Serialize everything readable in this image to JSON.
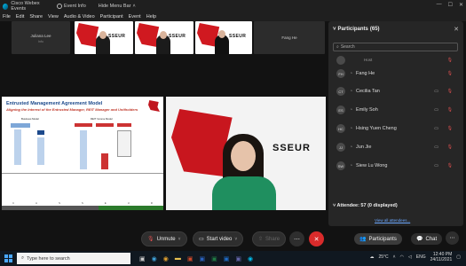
{
  "titlebar": {
    "app_name": "Cisco Webex Events",
    "event_info": "Event Info",
    "hide_menu": "Hide Menu Bar",
    "controls": [
      "—",
      "☐",
      "✕"
    ]
  },
  "menubar": {
    "items": [
      "File",
      "Edit",
      "Share",
      "View",
      "Audio & Video",
      "Participant",
      "Event",
      "Help"
    ]
  },
  "filmstrip": {
    "tiles": [
      {
        "name": "Juliana Lee",
        "sub": "Info"
      },
      {
        "brand": "SSEUR"
      },
      {
        "brand": "SSEUR"
      },
      {
        "brand": "SSEUR"
      },
      {
        "name": "Fang He"
      }
    ]
  },
  "slide": {
    "title": "Entrusted Management Agreement Model",
    "subtitle": "Aligning the Interest of the Entrusted Manager, REIT Manager and Unitholders",
    "col1": "Business Model",
    "col2": "REIT Income Model",
    "letters": [
      "C",
      "A",
      "S",
      "S",
      "E",
      "U",
      "R"
    ]
  },
  "speaker": {
    "brand": "SSEUR"
  },
  "controls": {
    "unmute": "Unmute",
    "start_video": "Start video",
    "share": "Share",
    "more": "⋯",
    "end": "✕",
    "participants": "Participants",
    "chat": "Chat"
  },
  "panel": {
    "title": "Participants",
    "count": "(65)",
    "search_placeholder": "Search",
    "participants": [
      {
        "initials": "",
        "name": "",
        "role": "Host"
      },
      {
        "initials": "FH",
        "name": "Fang He"
      },
      {
        "initials": "CT",
        "name": "Cecilia Tan"
      },
      {
        "initials": "ES",
        "name": "Emily Soh"
      },
      {
        "initials": "HC",
        "name": "Hsing Yuen Cheng"
      },
      {
        "initials": "JJ",
        "name": "Jun Jie"
      },
      {
        "initials": "SW",
        "name": "Siew Lu Wong"
      }
    ],
    "attendees": "Attendee: 57 (0 displayed)",
    "view_all": "View all attendees..."
  },
  "taskbar": {
    "search_placeholder": "Type here to search",
    "temperature": "25°C",
    "lang": "ENG",
    "time": "12:40 PM",
    "date": "24/11/2021"
  },
  "colors": {
    "brand_red": "#c8161e",
    "end_red": "#d92b2b",
    "panel_bg": "#262626"
  }
}
